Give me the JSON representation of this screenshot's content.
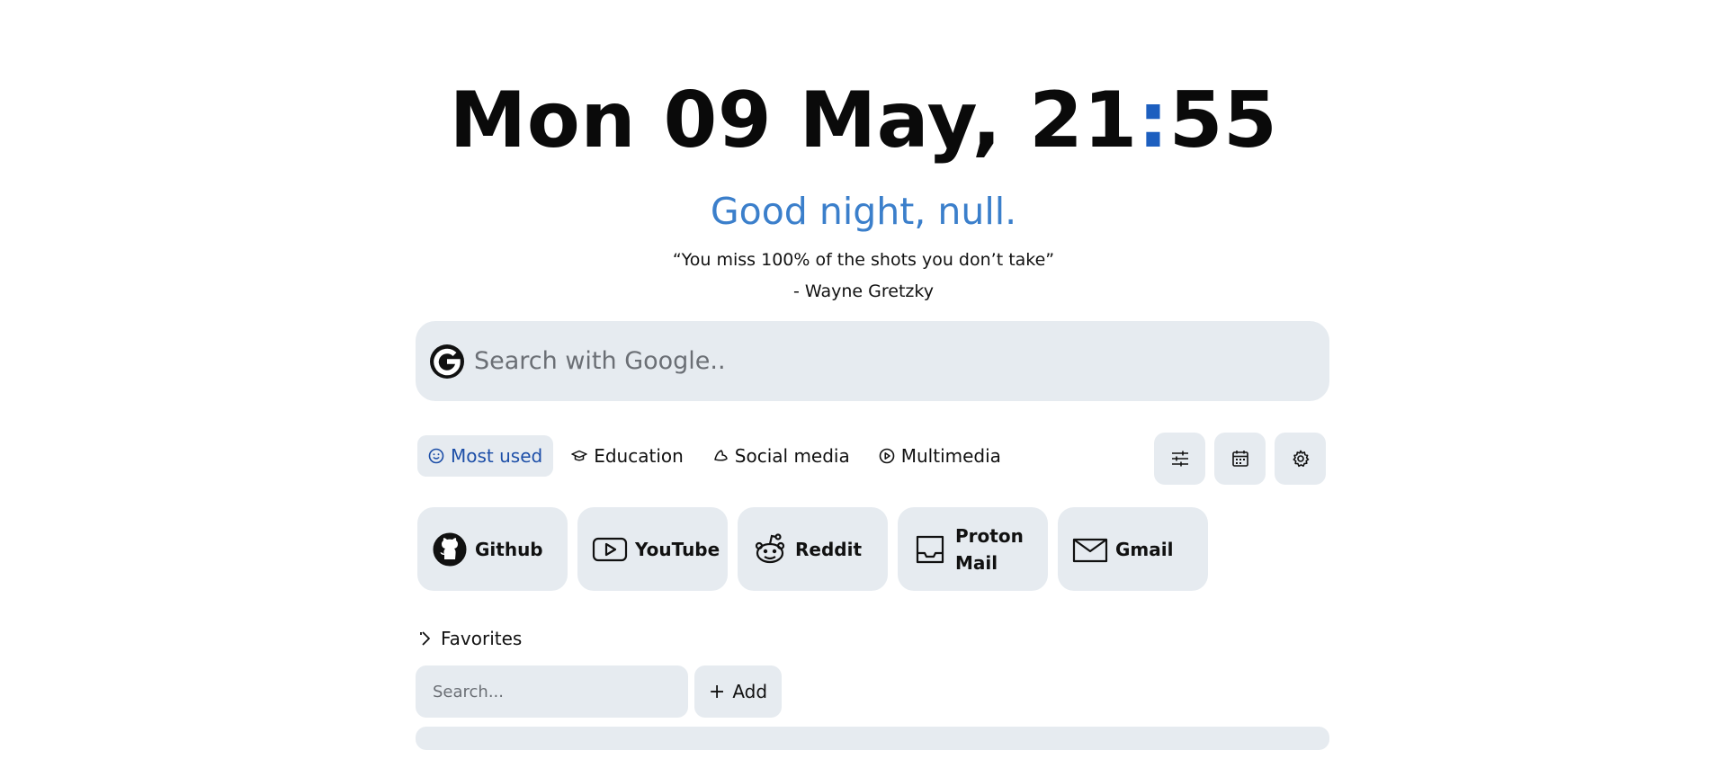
{
  "clock": {
    "date": "Mon 09 May, 21",
    "colon": ":",
    "minutes": "55",
    "colon_color": "#1d5fbf"
  },
  "greeting": "Good night, null.",
  "quote": {
    "text": "“You miss 100% of the shots you don’t take”",
    "author": "- Wayne Gretzky"
  },
  "search": {
    "placeholder": "Search with Google..",
    "icon": "google-icon"
  },
  "tabs": [
    {
      "label": "Most used",
      "icon": "smile-icon",
      "active": true
    },
    {
      "label": "Education",
      "icon": "graduation-cap-icon",
      "active": false
    },
    {
      "label": "Social media",
      "icon": "bird-icon",
      "active": false
    },
    {
      "label": "Multimedia",
      "icon": "play-circle-icon",
      "active": false
    }
  ],
  "tools": [
    {
      "icon": "sliders-icon"
    },
    {
      "icon": "calendar-icon"
    },
    {
      "icon": "gear-icon"
    }
  ],
  "shortcuts": [
    {
      "label": "Github",
      "icon": "github-icon"
    },
    {
      "label": "YouTube",
      "icon": "youtube-icon"
    },
    {
      "label": "Reddit",
      "icon": "reddit-icon"
    },
    {
      "label": "Proton Mail",
      "icon": "inbox-icon"
    },
    {
      "label": "Gmail",
      "icon": "mail-icon"
    }
  ],
  "favorites": {
    "title": "Favorites",
    "search_placeholder": "Search...",
    "add_label": "Add",
    "plus_glyph": "+"
  },
  "colors": {
    "accent": "#3b7fcb",
    "active_tab": "#1d4fa8",
    "surface": "#e6ebf0"
  }
}
